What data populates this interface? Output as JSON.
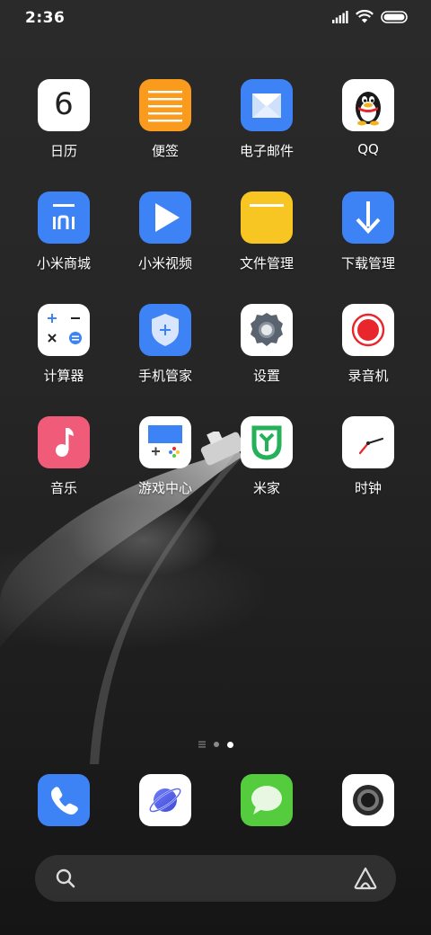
{
  "status_bar": {
    "time": "2:36"
  },
  "apps": [
    {
      "label": "日历",
      "icon": "calendar-icon",
      "date": "6"
    },
    {
      "label": "便签",
      "icon": "notes-icon"
    },
    {
      "label": "电子邮件",
      "icon": "email-icon"
    },
    {
      "label": "QQ",
      "icon": "qq-penguin-icon"
    },
    {
      "label": "小米商城",
      "icon": "mi-store-icon"
    },
    {
      "label": "小米视频",
      "icon": "video-play-icon"
    },
    {
      "label": "文件管理",
      "icon": "file-manager-icon"
    },
    {
      "label": "下载管理",
      "icon": "download-arrow-icon"
    },
    {
      "label": "计算器",
      "icon": "calculator-icon"
    },
    {
      "label": "手机管家",
      "icon": "security-shield-icon"
    },
    {
      "label": "设置",
      "icon": "settings-gear-icon"
    },
    {
      "label": "录音机",
      "icon": "recorder-icon"
    },
    {
      "label": "音乐",
      "icon": "music-note-icon"
    },
    {
      "label": "游戏中心",
      "icon": "game-center-icon"
    },
    {
      "label": "米家",
      "icon": "mijia-icon"
    },
    {
      "label": "时钟",
      "icon": "clock-icon"
    }
  ],
  "page_indicator": {
    "pages": 3,
    "current": 3
  },
  "dock": [
    {
      "icon": "phone-icon",
      "color": "#3d83f6"
    },
    {
      "icon": "browser-planet-icon",
      "color": "#ffffff"
    },
    {
      "icon": "messages-bubble-icon",
      "color": "#54cc3d"
    },
    {
      "icon": "camera-lens-icon",
      "color": "#ffffff"
    }
  ],
  "search_bar": {
    "left_icon": "search-icon",
    "right_icon": "assistant-icon"
  },
  "colors": {
    "accent_blue": "#3d83f6",
    "notes_orange": "#fb9b1d",
    "files_yellow": "#f7c623",
    "music_pink": "#f05b7a",
    "messages_green": "#54cc3d",
    "recorder_red": "#e8262b"
  }
}
